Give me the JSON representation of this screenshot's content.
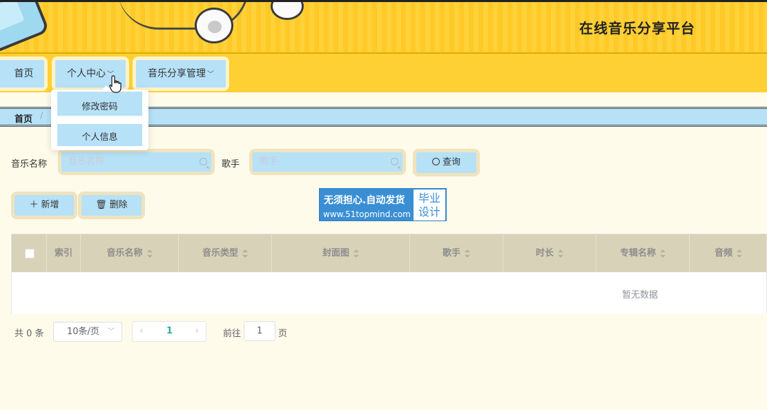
{
  "header": {
    "site_title": "在线音乐分享平台"
  },
  "nav": {
    "home": "首页",
    "personal_center": "个人中心",
    "music_share_mgmt": "音乐分享管理"
  },
  "dropdown": {
    "items": [
      "修改密码",
      "个人信息"
    ]
  },
  "breadcrumb": {
    "home": "首页",
    "sep": "/"
  },
  "search": {
    "music_name_label": "音乐名称",
    "music_name_placeholder": "音乐名称",
    "singer_label": "歌手",
    "singer_placeholder": "歌手",
    "query_button": "查询"
  },
  "actions": {
    "add": "新增",
    "delete": "删除"
  },
  "ad": {
    "line1": "无须担心.自动发货",
    "line2": "www.51topmind.com",
    "badge_top": "毕业",
    "badge_bottom": "设计"
  },
  "table": {
    "columns": [
      "索引",
      "音乐名称",
      "音乐类型",
      "封面图",
      "歌手",
      "时长",
      "专辑名称",
      "音频"
    ],
    "empty_text": "暂无数据"
  },
  "pagination": {
    "total": "共 0 条",
    "page_size": "10条/页",
    "current_page": "1",
    "goto_label": "前往",
    "goto_value": "1",
    "goto_unit": "页"
  },
  "colors": {
    "accent_blue": "#b6e1f7",
    "header_yellow": "#ffd033",
    "page_bg": "#fffbea",
    "active_page": "#2fae9a"
  }
}
